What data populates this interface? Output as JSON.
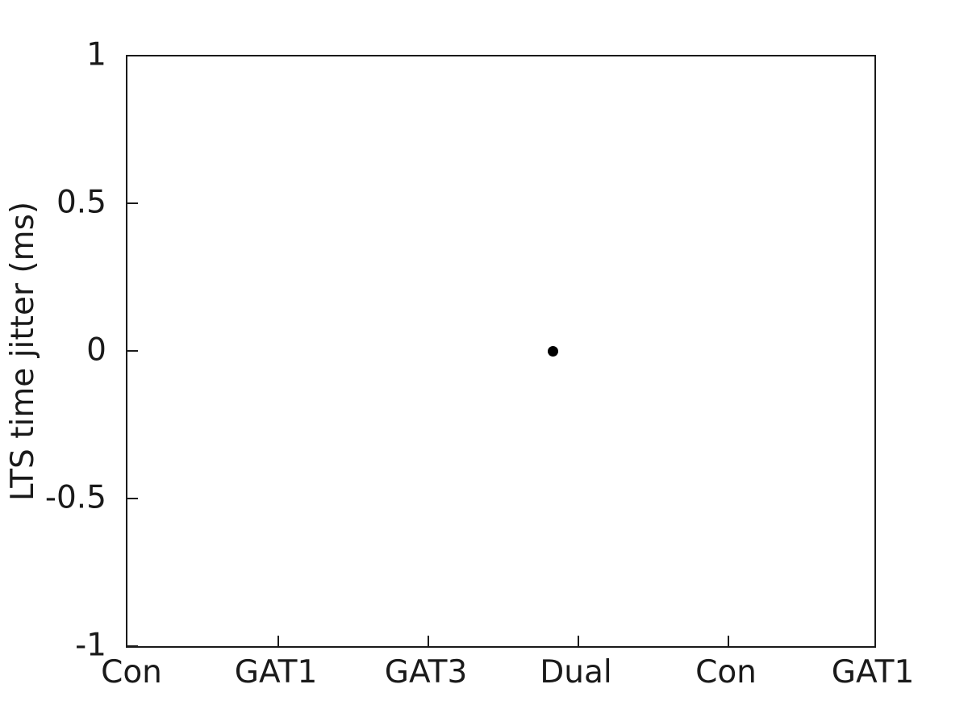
{
  "chart_data": {
    "type": "scatter",
    "title": "",
    "subtitle": "",
    "xlabel": "",
    "ylabel": "LTS time jitter (ms)",
    "categories": [
      "Con",
      "GAT1",
      "GAT3",
      "Dual",
      "Con",
      "GAT1"
    ],
    "x_tick_labels": [
      "Con",
      "GAT1",
      "GAT3",
      "Dual",
      "Con",
      "GAT1"
    ],
    "x_tick_values": [
      1,
      2,
      3,
      4,
      5,
      6
    ],
    "xlim": [
      1,
      6
    ],
    "y_tick_labels": [
      "1",
      "0.5",
      "0",
      "-0.5",
      "-1"
    ],
    "y_tick_values": [
      1,
      0.5,
      0,
      -0.5,
      -1
    ],
    "ylim": [
      -1,
      1
    ],
    "grid": false,
    "legend": null,
    "series": [
      {
        "name": "LTS time jitter",
        "marker": "filled-circle",
        "color": "#000000",
        "marker_size_px": 13,
        "points": [
          {
            "x": 3.835,
            "y": 0,
            "category": "Dual",
            "label": ""
          }
        ]
      }
    ],
    "annotations": [],
    "colors": {
      "axis": "#1a1a1a",
      "background": "#ffffff",
      "marker": "#000000"
    }
  },
  "figure": {
    "background_color": "#ffffff",
    "axis_color": "#1a1a1a",
    "box_on": true,
    "tick_direction": "in"
  }
}
